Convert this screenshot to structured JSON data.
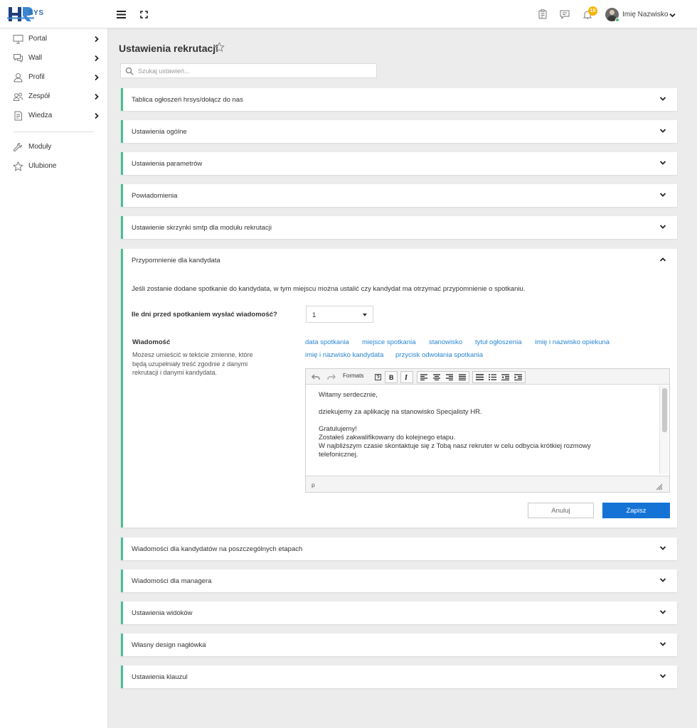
{
  "brand": {
    "logo_text": "SYS",
    "logo_letters": "HR"
  },
  "topbar": {
    "notification_count": "10",
    "user_name": "Imię Nazwisko"
  },
  "sidebar": {
    "items": [
      {
        "label": "Portal",
        "icon": "monitor-icon"
      },
      {
        "label": "Wall",
        "icon": "chat-icon"
      },
      {
        "label": "Profil",
        "icon": "user-icon"
      },
      {
        "label": "Zespół",
        "icon": "team-icon"
      },
      {
        "label": "Wiedza",
        "icon": "document-icon"
      }
    ],
    "bottom_items": [
      {
        "label": "Moduły",
        "icon": "wrench-icon"
      },
      {
        "label": "Ulubione",
        "icon": "star-icon"
      }
    ]
  },
  "page": {
    "title": "Ustawienia rekrutacji",
    "search_placeholder": "Szukaj ustawień..."
  },
  "sections_top": [
    "Tablica ogłoszeń hrsys/dołącz do nas",
    "Ustawienia ogólne",
    "Ustawienia parametrów",
    "Powiadomienia",
    "Ustawienie skrzynki smtp dla modułu rekrutacji"
  ],
  "open_section": {
    "title": "Przypomnienie dla kandydata",
    "description": "Jeśli zostanie dodane spotkanie do kandydata, w tym miejscu można ustalić czy kandydat ma otrzymać przypomnienie o spotkaniu.",
    "days_question": "Ile dni przed spotkaniem wysłać wiadomość?",
    "days_value": "1",
    "message_label": "Wiadomość",
    "message_help": "Możesz umieścić w tekście zmienne, które będą uzupełniały treść zgodnie z danymi rekrutacji i danymi kandydata.",
    "variables": [
      "data spotkania",
      "miejsce spotkania",
      "stanowisko",
      "tytuł ogłoszenia",
      "imię i nazwisko opiekuna",
      "imię i nazwisko kandydata",
      "przycisk odwołania spotkania"
    ],
    "editor": {
      "formats_label": "Formats",
      "lines": [
        "Witamy serdecznie,",
        "dziekujemy za aplikację na stanowisko Specjalisty HR.",
        "Gratulujemy!",
        "Zostałeś zakwalifikowany do kolejnego etapu.",
        "W najbliższym czasie skontaktuje się z Tobą nasz rekruter w celu odbycia krótkiej rozmowy",
        "telefonicznej."
      ],
      "status_path": "p"
    },
    "cancel_label": "Anuluj",
    "save_label": "Zapisz"
  },
  "sections_bottom": [
    "Wiadomości dla kandydatów na poszczególnych etapach",
    "Wiadomości dla managera",
    "Ustawienia widoków",
    "Własny design nagłówka",
    "Ustawienia klauzul"
  ],
  "colors": {
    "accent_green": "#47c08f",
    "link_blue": "#2c86d1",
    "primary_button": "#1573d6",
    "badge_yellow": "#f5b400",
    "logo_blue": "#2e6ba8"
  }
}
